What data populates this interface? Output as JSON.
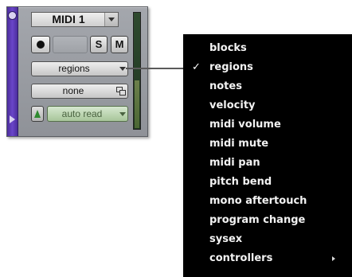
{
  "track": {
    "name": "MIDI 1",
    "solo_label": "S",
    "mute_label": "M",
    "view_selector": "regions",
    "playlist": "none",
    "automation_mode": "auto read"
  },
  "menu": {
    "items": [
      {
        "label": "blocks",
        "checked": ""
      },
      {
        "label": "regions",
        "checked": "✓"
      },
      {
        "label": "notes",
        "checked": ""
      },
      {
        "label": "velocity",
        "checked": ""
      },
      {
        "label": "midi volume",
        "checked": ""
      },
      {
        "label": "midi mute",
        "checked": ""
      },
      {
        "label": "midi pan",
        "checked": ""
      },
      {
        "label": "pitch bend",
        "checked": ""
      },
      {
        "label": "mono aftertouch",
        "checked": ""
      },
      {
        "label": "program change",
        "checked": ""
      },
      {
        "label": "sysex",
        "checked": ""
      },
      {
        "label": "controllers",
        "checked": "",
        "has_submenu": true
      }
    ]
  },
  "colors": {
    "track_color": "#5a3bb5",
    "menu_background": "#000000",
    "menu_text": "#f2f2f2",
    "automation_green": "#2f8a2f"
  },
  "icons": {
    "record": "record-enable-icon",
    "playlist": "playlist-icon",
    "automation": "automation-mode-icon",
    "dropdown": "chevron-down-icon",
    "submenu": "chevron-right-icon",
    "check": "checkmark-icon"
  }
}
